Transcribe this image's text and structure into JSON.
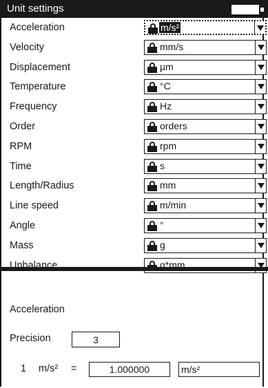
{
  "header": {
    "title": "Unit settings"
  },
  "units": [
    {
      "label": "Acceleration",
      "unit": "m/s²",
      "selected": true
    },
    {
      "label": "Velocity",
      "unit": "mm/s"
    },
    {
      "label": "Displacement",
      "unit": "µm"
    },
    {
      "label": "Temperature",
      "unit": "°C"
    },
    {
      "label": "Frequency",
      "unit": "Hz"
    },
    {
      "label": "Order",
      "unit": "orders"
    },
    {
      "label": "RPM",
      "unit": "rpm"
    },
    {
      "label": "Time",
      "unit": "s"
    },
    {
      "label": "Length/Radius",
      "unit": "mm"
    },
    {
      "label": "Line speed",
      "unit": "m/min"
    },
    {
      "label": "Angle",
      "unit": "°"
    },
    {
      "label": "Mass",
      "unit": "g"
    },
    {
      "label": "Unbalance",
      "unit": "g*mm"
    }
  ],
  "detail": {
    "title": "Acceleration",
    "precision_label": "Precision",
    "precision_value": "3",
    "conversion": {
      "one": "1",
      "from_unit": "m/s²",
      "equals": "=",
      "value": "1.000000",
      "to_unit": "m/s²"
    }
  },
  "colors": {
    "foreground": "#1a1a1a",
    "background": "#ffffff"
  },
  "icons": {
    "lock": "lock-icon",
    "dropdown": "chevron-down-icon",
    "battery": "battery-icon"
  }
}
